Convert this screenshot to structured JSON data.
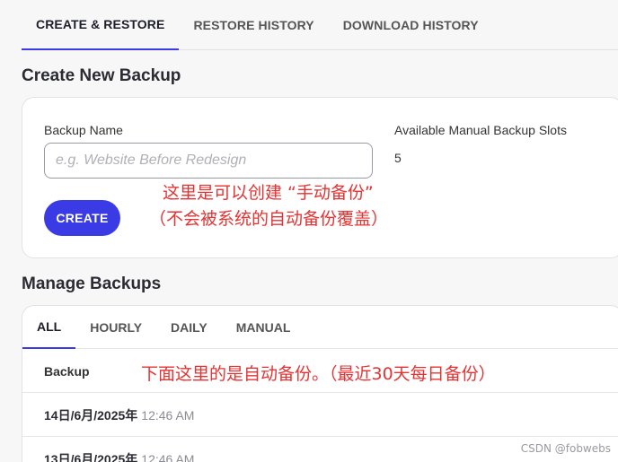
{
  "tabs": [
    {
      "label": "CREATE & RESTORE",
      "active": true
    },
    {
      "label": "RESTORE HISTORY",
      "active": false
    },
    {
      "label": "DOWNLOAD HISTORY",
      "active": false
    }
  ],
  "create": {
    "title": "Create New Backup",
    "name_label": "Backup Name",
    "name_placeholder": "e.g. Website Before Redesign",
    "name_value": "",
    "slots_label": "Available Manual Backup Slots",
    "slots_value": "5",
    "create_button": "CREATE"
  },
  "annotations": {
    "create_line1": "这里是可以创建 “手动备份”",
    "create_line2": "（不会被系统的自动备份覆盖）",
    "manage_note": "下面这里的是自动备份。（最近30天每日备份）"
  },
  "manage": {
    "title": "Manage Backups",
    "filters": [
      {
        "label": "ALL",
        "active": true
      },
      {
        "label": "HOURLY",
        "active": false
      },
      {
        "label": "DAILY",
        "active": false
      },
      {
        "label": "MANUAL",
        "active": false
      }
    ],
    "column_header": "Backup",
    "rows": [
      {
        "date": "14日/6月/2025年",
        "time": "12:46 AM"
      },
      {
        "date": "13日/6月/2025年",
        "time": "12:46 AM"
      }
    ]
  },
  "watermark": "CSDN @fobwebs",
  "colors": {
    "accent": "#3b3be6",
    "annotation": "#e53333"
  }
}
